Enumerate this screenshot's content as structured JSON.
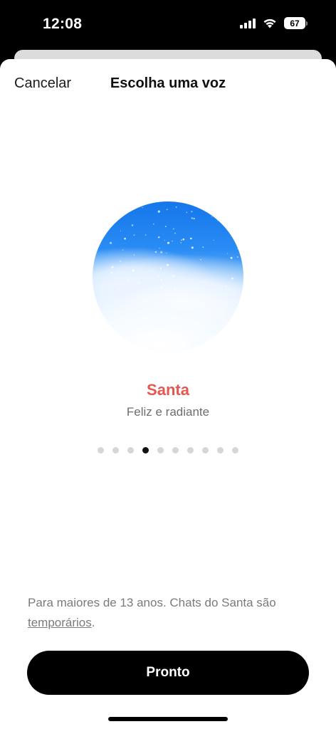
{
  "status_bar": {
    "time": "12:08",
    "battery": "67",
    "icons": [
      "cellular-signal-icon",
      "wifi-icon",
      "battery-icon"
    ]
  },
  "header": {
    "cancel_label": "Cancelar",
    "title": "Escolha uma voz"
  },
  "voice": {
    "name": "Santa",
    "description": "Feliz e radiante",
    "name_color": "#e6574f",
    "orb_colors": [
      "#1577ea",
      "#79b9f7",
      "#ffffff"
    ]
  },
  "pager": {
    "total": 10,
    "active_index": 3
  },
  "notice": {
    "text": "Para maiores de 13 anos. Chats do Santa são ",
    "link": "temporários",
    "suffix": "."
  },
  "footer": {
    "done_label": "Pronto"
  }
}
